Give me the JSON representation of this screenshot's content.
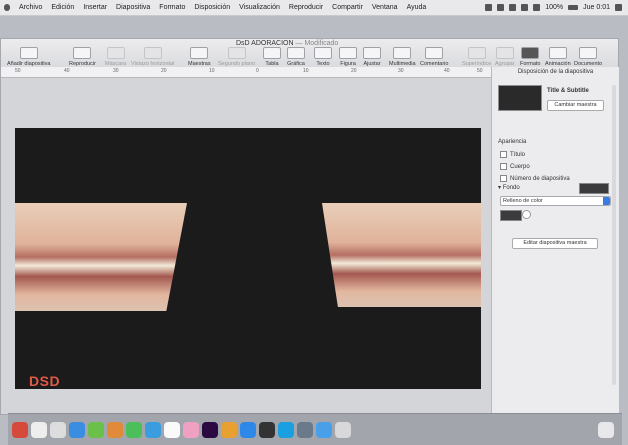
{
  "menubar": {
    "items": [
      "Archivo",
      "Edición",
      "Insertar",
      "Diapositiva",
      "Formato",
      "Disposición",
      "Visualización",
      "Reproducir",
      "Compartir",
      "Ventana",
      "Ayuda"
    ],
    "battery": "100%",
    "clock": "Jue 0:01"
  },
  "window": {
    "title": "DsD ADORACION",
    "status": "— Modificado",
    "toolbar": [
      {
        "label": "Añadir diapositiva",
        "dim": false
      },
      {
        "label": "Reproducir",
        "dim": false
      },
      {
        "label": "Máscara",
        "dim": true
      },
      {
        "label": "Vistazo horizontal",
        "dim": true
      },
      {
        "label": "Maestras",
        "dim": false
      },
      {
        "label": "Segundo plano",
        "dim": true
      },
      {
        "label": "Tabla",
        "dim": false
      },
      {
        "label": "Gráfica",
        "dim": false
      },
      {
        "label": "Texto",
        "dim": false
      },
      {
        "label": "Figura",
        "dim": false
      },
      {
        "label": "Ajustar",
        "dim": false
      },
      {
        "label": "Multimedia",
        "dim": false
      },
      {
        "label": "Comentario",
        "dim": false
      },
      {
        "label": "Superíndice",
        "dim": true
      },
      {
        "label": "Agrupar",
        "dim": true
      },
      {
        "label": "Formato",
        "dim": false
      },
      {
        "label": "Animación",
        "dim": false
      },
      {
        "label": "Documento",
        "dim": false
      }
    ],
    "ruler": [
      "50",
      "40",
      "30",
      "20",
      "10",
      "0",
      "10",
      "20",
      "30",
      "40",
      "50"
    ]
  },
  "slide": {
    "logo": "DSD"
  },
  "panel": {
    "title": "Disposición de la diapositiva",
    "master_name": "Title & Subtitle",
    "change_master": "Cambiar maestra",
    "appearance_label": "Apariencia",
    "checkboxes": [
      "Título",
      "Cuerpo",
      "Número de diapositiva"
    ],
    "background_label": "Fondo",
    "fill_select": "Relleno de color",
    "edit_master": "Editar diapositiva maestra"
  }
}
